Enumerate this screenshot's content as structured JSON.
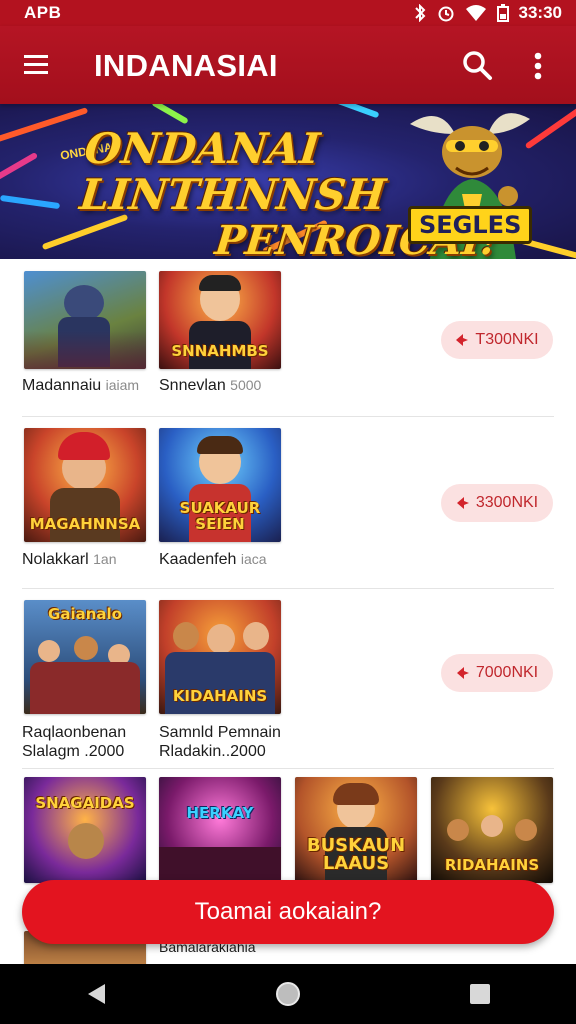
{
  "status_bar": {
    "carrier": "APB",
    "time": "33:30"
  },
  "app_bar": {
    "title": "INDANASIAI"
  },
  "banner": {
    "small_text": "ONDANAI",
    "line1": "ONDANAI LINTHNNSH",
    "line2": "PENROICAI!",
    "badge": "SEGLES"
  },
  "rows": [
    {
      "thumbs": [
        {
          "caption": ""
        },
        {
          "caption": "SNNAHMBS"
        }
      ],
      "labels": [
        {
          "title": "Madannaiu",
          "sub": "iaiam"
        },
        {
          "title": "Snnevlan",
          "sub": "5000"
        }
      ],
      "price": "T300NKI"
    },
    {
      "thumbs": [
        {
          "caption": "MAGAHNNSA"
        },
        {
          "caption": "SUAKAUR SEIEN"
        }
      ],
      "labels": [
        {
          "title": "Nolakkarl",
          "sub": "1an"
        },
        {
          "title": "Kaadenfeh",
          "sub": "iaca"
        }
      ],
      "price": "3300NKI"
    },
    {
      "thumbs": [
        {
          "caption": "Gaianalo"
        },
        {
          "caption": "KIDAHAINS"
        }
      ],
      "labels": [
        {
          "title": "Raqlaonbenan",
          "sub": "Slalagm .2000"
        },
        {
          "title": "Samnld Pemnain",
          "sub": "Rladakin..2000"
        }
      ],
      "price": "7000NKI"
    }
  ],
  "grid_row": {
    "thumbs": [
      {
        "caption": "SNAGAIDAS"
      },
      {
        "caption": "HERKAY"
      },
      {
        "caption": "BUSKAUN LAAUS"
      },
      {
        "caption": "RIDAHAINS"
      }
    ],
    "label": "Bamalarakiahia"
  },
  "cta": {
    "label": "Toamai aokaiain?"
  },
  "colors": {
    "primary": "#b3121f",
    "accent": "#e3141f",
    "price_bg": "#fbe1e1",
    "price_text": "#c0272d"
  },
  "icons": [
    "menu-icon",
    "search-icon",
    "more-vert-icon",
    "tag-icon",
    "back-icon",
    "home-icon",
    "recents-icon"
  ]
}
